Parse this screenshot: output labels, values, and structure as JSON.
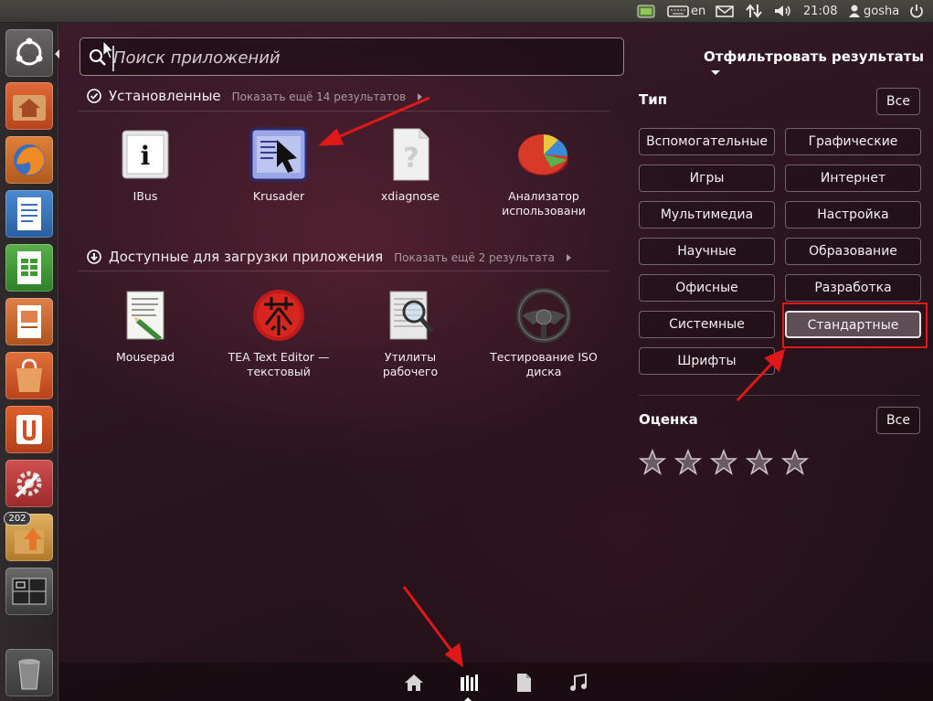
{
  "top_panel": {
    "keyboard_layout": "en",
    "time": "21:08",
    "user": "gosha"
  },
  "launcher": {
    "items": [
      {
        "name": "dash-home",
        "icon": "ubuntu-logo-icon"
      },
      {
        "name": "home-folder",
        "icon": "home-folder-icon"
      },
      {
        "name": "firefox",
        "icon": "firefox-icon"
      },
      {
        "name": "libreoffice-writer",
        "icon": "writer-icon"
      },
      {
        "name": "libreoffice-calc",
        "icon": "calc-icon"
      },
      {
        "name": "libreoffice-impress",
        "icon": "impress-icon"
      },
      {
        "name": "software-center",
        "icon": "software-center-icon"
      },
      {
        "name": "ubuntu-one",
        "icon": "ubuntu-one-icon"
      },
      {
        "name": "system-settings",
        "icon": "settings-icon"
      },
      {
        "name": "update-manager",
        "icon": "update-icon",
        "badge": "202"
      },
      {
        "name": "workspace-switcher",
        "icon": "workspace-icon"
      },
      {
        "name": "trash",
        "icon": "trash-icon"
      }
    ]
  },
  "search": {
    "placeholder": "Поиск приложений"
  },
  "installed": {
    "title": "Установленные",
    "more": "Показать ещё 14 результатов",
    "apps": [
      {
        "label": "IBus",
        "icon": "ibus-icon"
      },
      {
        "label": "Krusader",
        "icon": "krusader-icon"
      },
      {
        "label": "xdiagnose",
        "icon": "unknown-file-icon"
      },
      {
        "label": "Анализатор использовани",
        "icon": "disk-usage-pie-icon"
      }
    ]
  },
  "available": {
    "title": "Доступные для загрузки приложения",
    "more": "Показать ещё 2 результата",
    "apps": [
      {
        "label": "Mousepad",
        "icon": "mousepad-icon"
      },
      {
        "label": "TEA Text Editor — текстовый",
        "icon": "tea-icon"
      },
      {
        "label": "Утилиты рабочего",
        "icon": "search-document-icon"
      },
      {
        "label": "Тестирование ISO диска",
        "icon": "steering-wheel-icon"
      }
    ]
  },
  "filters": {
    "title": "Отфильтровать результаты",
    "type_title": "Тип",
    "all_label": "Все",
    "types": [
      "Вспомогательные",
      "Графические",
      "Игры",
      "Интернет",
      "Мультимедиа",
      "Настройка",
      "Научные",
      "Образование",
      "Офисные",
      "Разработка",
      "Системные",
      "Стандартные",
      "Шрифты"
    ],
    "active_type": "Стандартные",
    "rating_title": "Оценка",
    "rating_all_label": "Все",
    "stars": 5
  },
  "lenses": [
    "home-icon",
    "applications-icon",
    "files-icon",
    "music-icon"
  ],
  "colors": {
    "annotation_arrow": "#e01818",
    "annotation_box": "#e01818",
    "dash_bg": "#2b1520"
  }
}
